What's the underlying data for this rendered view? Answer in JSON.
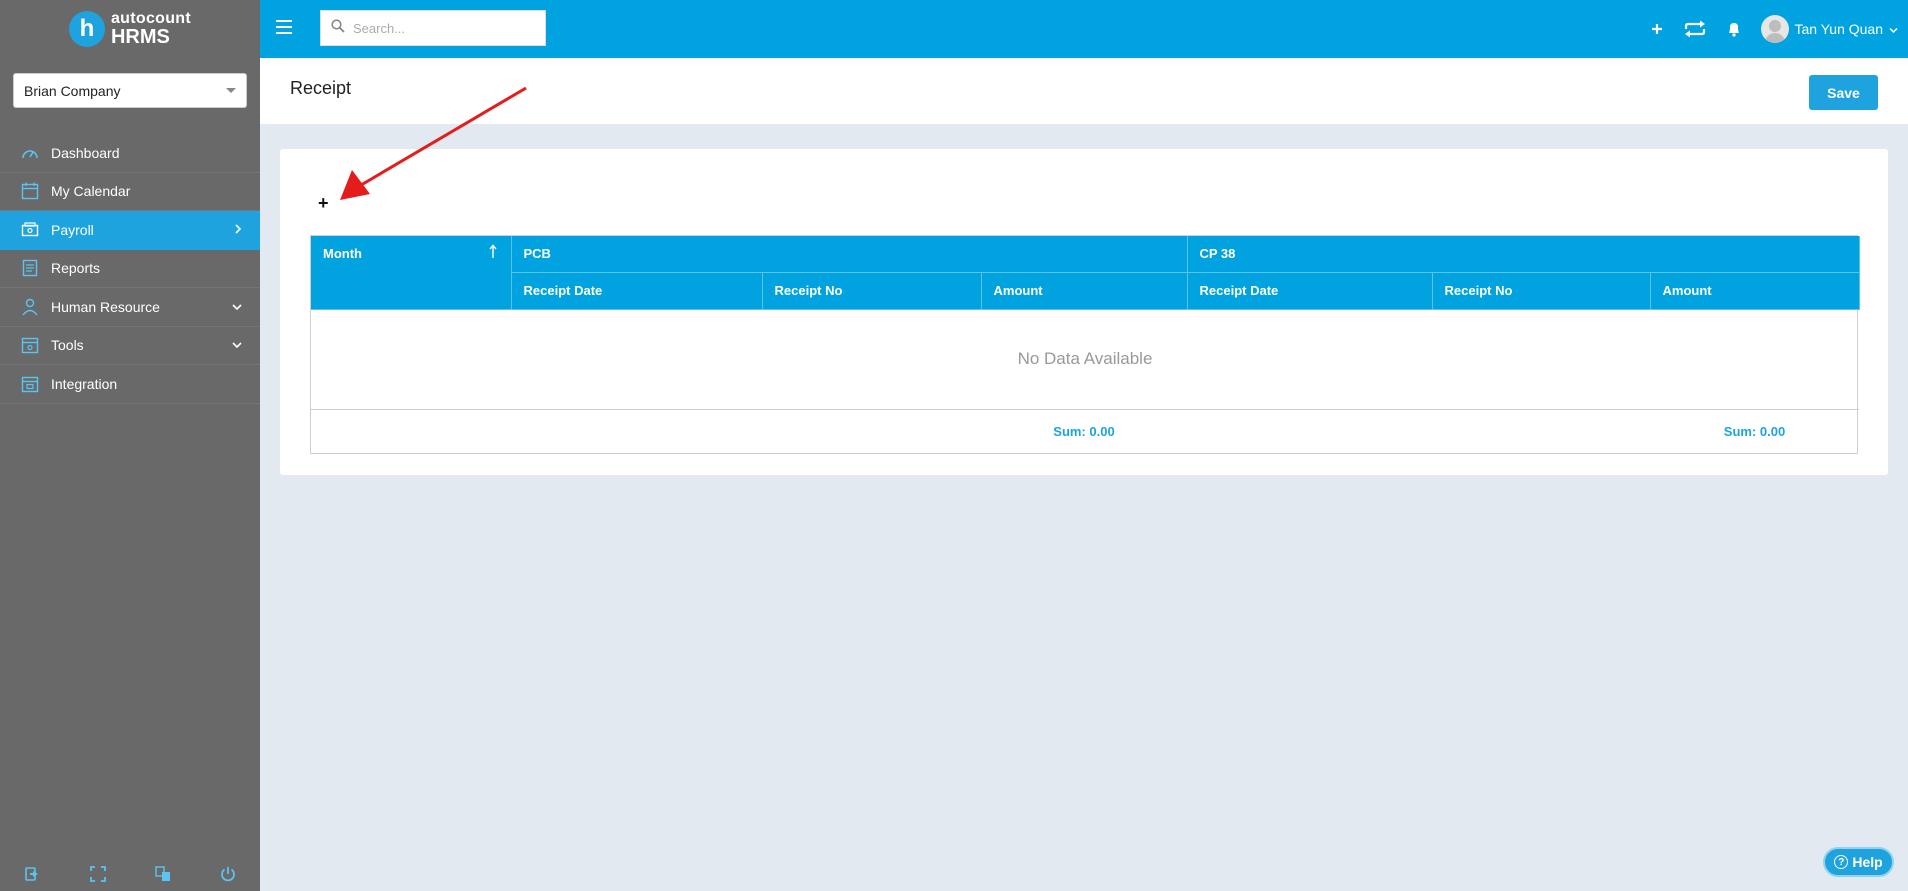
{
  "brand": {
    "top": "autocount",
    "bottom": "HRMS",
    "logo_letter": "h"
  },
  "company_select": {
    "value": "Brian Company"
  },
  "sidebar": {
    "items": [
      {
        "label": "Dashboard",
        "icon": "dashboard-icon"
      },
      {
        "label": "My Calendar",
        "icon": "calendar-icon"
      },
      {
        "label": "Payroll",
        "icon": "payroll-icon",
        "active": true,
        "chevron": "chevron-right-icon"
      },
      {
        "label": "Reports",
        "icon": "reports-icon"
      },
      {
        "label": "Human Resource",
        "icon": "human-resource-icon",
        "chevron": "chevron-down-icon"
      },
      {
        "label": "Tools",
        "icon": "tools-icon",
        "chevron": "chevron-down-icon"
      },
      {
        "label": "Integration",
        "icon": "integration-icon"
      }
    ],
    "footer_icons": [
      "logout-icon",
      "fullscreen-icon",
      "translate-icon",
      "power-icon"
    ]
  },
  "topbar": {
    "search_placeholder": "Search...",
    "user_name": "Tan Yun Quan",
    "icons": [
      "plus-icon",
      "switch-icon",
      "bell-icon"
    ]
  },
  "page": {
    "title": "Receipt",
    "save_label": "Save",
    "add_label": "+"
  },
  "table": {
    "month_header": "Month",
    "group_headers": [
      "PCB",
      "CP 38"
    ],
    "sub_headers": [
      "Receipt Date",
      "Receipt No",
      "Amount",
      "Receipt Date",
      "Receipt No",
      "Amount"
    ],
    "empty_text": "No Data Available",
    "pcb_sum": "Sum: 0.00",
    "cp38_sum": "Sum: 0.00"
  },
  "help": {
    "label": "Help"
  },
  "colors": {
    "accent": "#00a3e0",
    "sidebar": "#696969",
    "annotation": "#e51c1c"
  }
}
